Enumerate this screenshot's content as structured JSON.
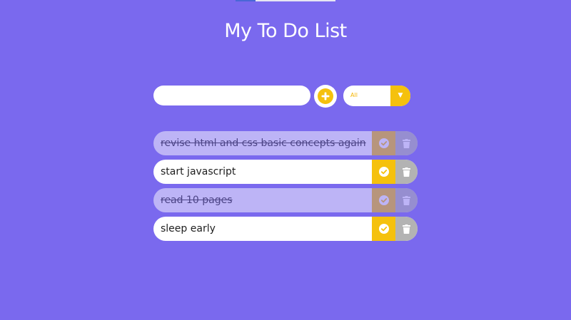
{
  "page": {
    "title": "My To Do List"
  },
  "form": {
    "input_value": "",
    "input_placeholder": "",
    "add_icon": "plus-circle-icon",
    "filter": {
      "selected": "All",
      "options": [
        "All"
      ],
      "arrow_icon": "chevron-down-icon"
    }
  },
  "todos": [
    {
      "text": "revise html and css basic concepts again",
      "completed": true
    },
    {
      "text": "start javascript",
      "completed": false
    },
    {
      "text": "read 10 pages",
      "completed": true
    },
    {
      "text": "sleep early",
      "completed": false
    }
  ],
  "item_icons": {
    "complete": "check-circle-icon",
    "delete": "trash-icon"
  },
  "colors": {
    "background": "#7a69ee",
    "accent": "#f5c10d",
    "delete": "#b3b3b3",
    "surface": "#ffffff"
  }
}
